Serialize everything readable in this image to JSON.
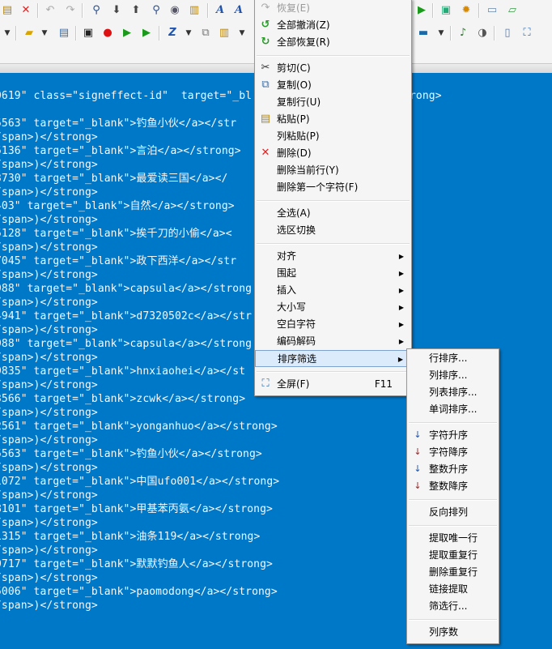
{
  "toolbar": {
    "row1_icons": [
      "clipboard-icon",
      "close-icon",
      "undo-icon",
      "redo-icon",
      "find-icon",
      "arrow-down-icon",
      "arrow-up-icon",
      "find-user-icon",
      "binoculars-icon",
      "paste-special-icon",
      "font-icon",
      "font-plus-icon",
      "play-icon",
      "page-icon",
      "gear-icon",
      "page-plain-icon",
      "page-green-icon"
    ],
    "row2_icons": [
      "folder-icon",
      "square-icon",
      "record-icon",
      "play-icon",
      "step-icon",
      "z-icon",
      "copy-list-icon",
      "refresh-icon",
      "window-icon",
      "music-icon",
      "disc-icon",
      "page-icon",
      "fullscreen-icon"
    ]
  },
  "editor": {
    "lines": [
      "0619\" class=\"signeffect-id\"  target=\"_bl",
      "5563\" target=\"_blank\">钓鱼小伙</a></str",
      "/span>)</strong>",
      "5136\" target=\"_blank\">言泊</a></strong>",
      "/span>)</strong>",
      "3730\" target=\"_blank\">最爱读三国</a></",
      "/span>)</strong>",
      "403\" target=\"_blank\">自然</a></strong>",
      "/span>)</strong>",
      "5128\" target=\"_blank\">挨千刀的小偷</a><",
      "/span>)</strong>",
      "7045\" target=\"_blank\">政下西洋</a></str",
      "/span>)</strong>",
      "988\" target=\"_blank\">capsula</a></strong",
      "/span>)</strong>",
      "4941\" target=\"_blank\">d7320502c</a></str",
      "/span>)</strong>",
      "988\" target=\"_blank\">capsula</a></strong",
      "/span>)</strong>",
      "9835\" target=\"_blank\">hnxiaohei</a></st",
      "/span>)</strong>",
      "3566\" target=\"_blank\">zcwk</a></strong>",
      "/span>)</strong>",
      "2561\" target=\"_blank\">yonganhuo</a></strong>",
      "/span>)</strong>",
      "5563\" target=\"_blank\">钓鱼小伙</a></strong>",
      "/span>)</strong>",
      "1072\" target=\"_blank\">中国ufo001</a></strong>",
      "/span>)</strong>",
      "8101\" target=\"_blank\">甲基苯丙氨</a></strong>",
      "/span>)</strong>",
      "1315\" target=\"_blank\">油条119</a></strong>",
      "/span>)</strong>",
      "0717\" target=\"_blank\">默默钓鱼人</a></strong>",
      "/span>)</strong>",
      "5006\" target=\"_blank\">paomodong</a></strong>",
      "/span>)</strong>"
    ],
    "line1_tail": "rong>"
  },
  "context_menu": {
    "redo": "恢复(E)",
    "undo_all": "全部撤消(Z)",
    "redo_all": "全部恢复(R)",
    "cut": "剪切(C)",
    "copy": "复制(O)",
    "copy_line": "复制行(U)",
    "paste": "粘贴(P)",
    "column_paste": "列粘贴(P)",
    "delete": "删除(D)",
    "delete_line": "删除当前行(Y)",
    "delete_first_char": "删除第一个字符(F)",
    "select_all": "全选(A)",
    "toggle_selection": "选区切换",
    "align": "对齐",
    "surround": "围起",
    "insert": "插入",
    "case": "大小写",
    "whitespace": "空白字符",
    "encode_decode": "编码解码",
    "sort_filter": "排序筛选",
    "fullscreen": "全屏(F)",
    "fullscreen_shortcut": "F11"
  },
  "submenu": {
    "line_sort": "行排序...",
    "column_sort": "列排序...",
    "list_sort": "列表排序...",
    "word_sort": "单词排序...",
    "char_asc": "字符升序",
    "char_desc": "字符降序",
    "int_asc": "整数升序",
    "int_desc": "整数降序",
    "reverse": "反向排列",
    "extract_unique": "提取唯一行",
    "extract_duplicates": "提取重复行",
    "remove_duplicates": "删除重复行",
    "extract_links": "链接提取",
    "filter_lines": "筛选行...",
    "column_count": "列序数"
  }
}
